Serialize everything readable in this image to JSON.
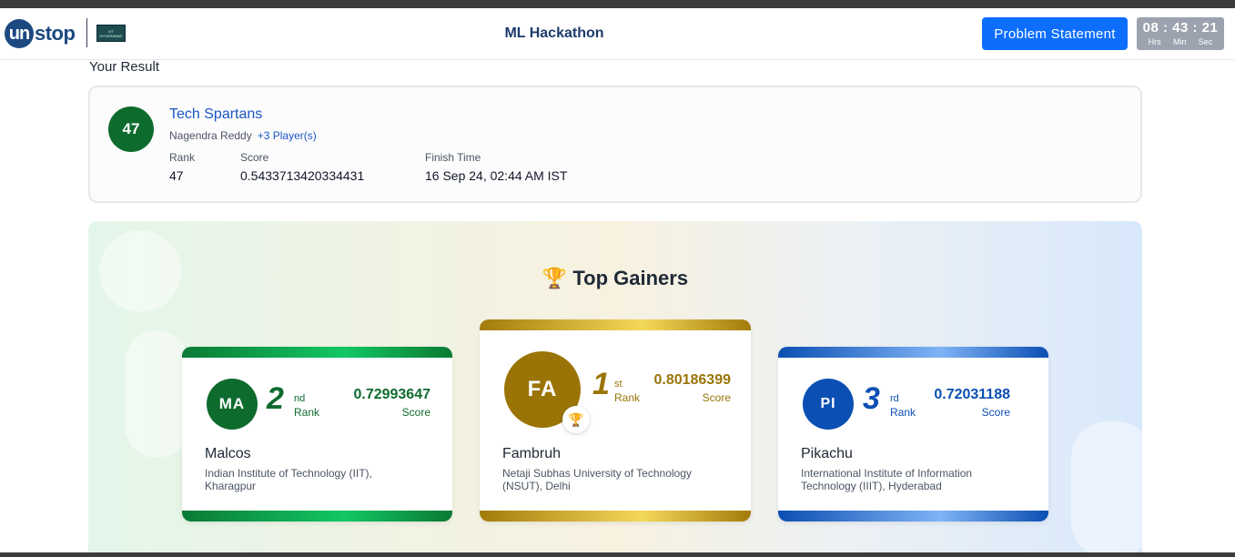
{
  "header": {
    "logo_mark": "un",
    "logo_text": "stop",
    "partner_logo_line1": "IIIT",
    "partner_logo_line2": "HYDERABAD",
    "title": "ML Hackathon",
    "problem_statement_label": "Problem Statement",
    "timer": {
      "display": "08 : 43 : 21",
      "units": [
        "Hrs",
        "Min",
        "Sec"
      ]
    }
  },
  "result": {
    "heading": "Your Result",
    "rank_badge": "47",
    "team_name": "Tech Spartans",
    "leader": "Nagendra Reddy",
    "players": "+3 Player(s)",
    "rank_label": "Rank",
    "rank_value": "47",
    "score_label": "Score",
    "score_value": "0.5433713420334431",
    "finish_label": "Finish Time",
    "finish_value": "16 Sep 24, 02:44 AM IST"
  },
  "gainers": {
    "title": "Top Gainers",
    "cards": [
      {
        "initials": "MA",
        "rank": "2",
        "suffix": "nd",
        "rank_word": "Rank",
        "score": "0.72993647",
        "score_word": "Score",
        "name": "Malcos",
        "college_line1": "Indian Institute of Technology (IIT),",
        "college_line2": "Kharagpur"
      },
      {
        "initials": "FA",
        "rank": "1",
        "suffix": "st",
        "rank_word": "Rank",
        "score": "0.80186399",
        "score_word": "Score",
        "name": "Fambruh",
        "college_line1": "Netaji Subhas University of Technology",
        "college_line2": "(NSUT), Delhi"
      },
      {
        "initials": "PI",
        "rank": "3",
        "suffix": "rd",
        "rank_word": "Rank",
        "score": "0.72031188",
        "score_word": "Score",
        "name": "Pikachu",
        "college_line1": "International Institute of Information",
        "college_line2": "Technology (IIIT), Hyderabad"
      }
    ]
  },
  "colors": {
    "silver_green": "#0e6b2e",
    "gold": "#9a7406",
    "bronze_blue": "#0b4fb3",
    "brand": "#1c4980",
    "primary": "#0d6efd"
  },
  "icons": {
    "trophy": "🏆"
  }
}
